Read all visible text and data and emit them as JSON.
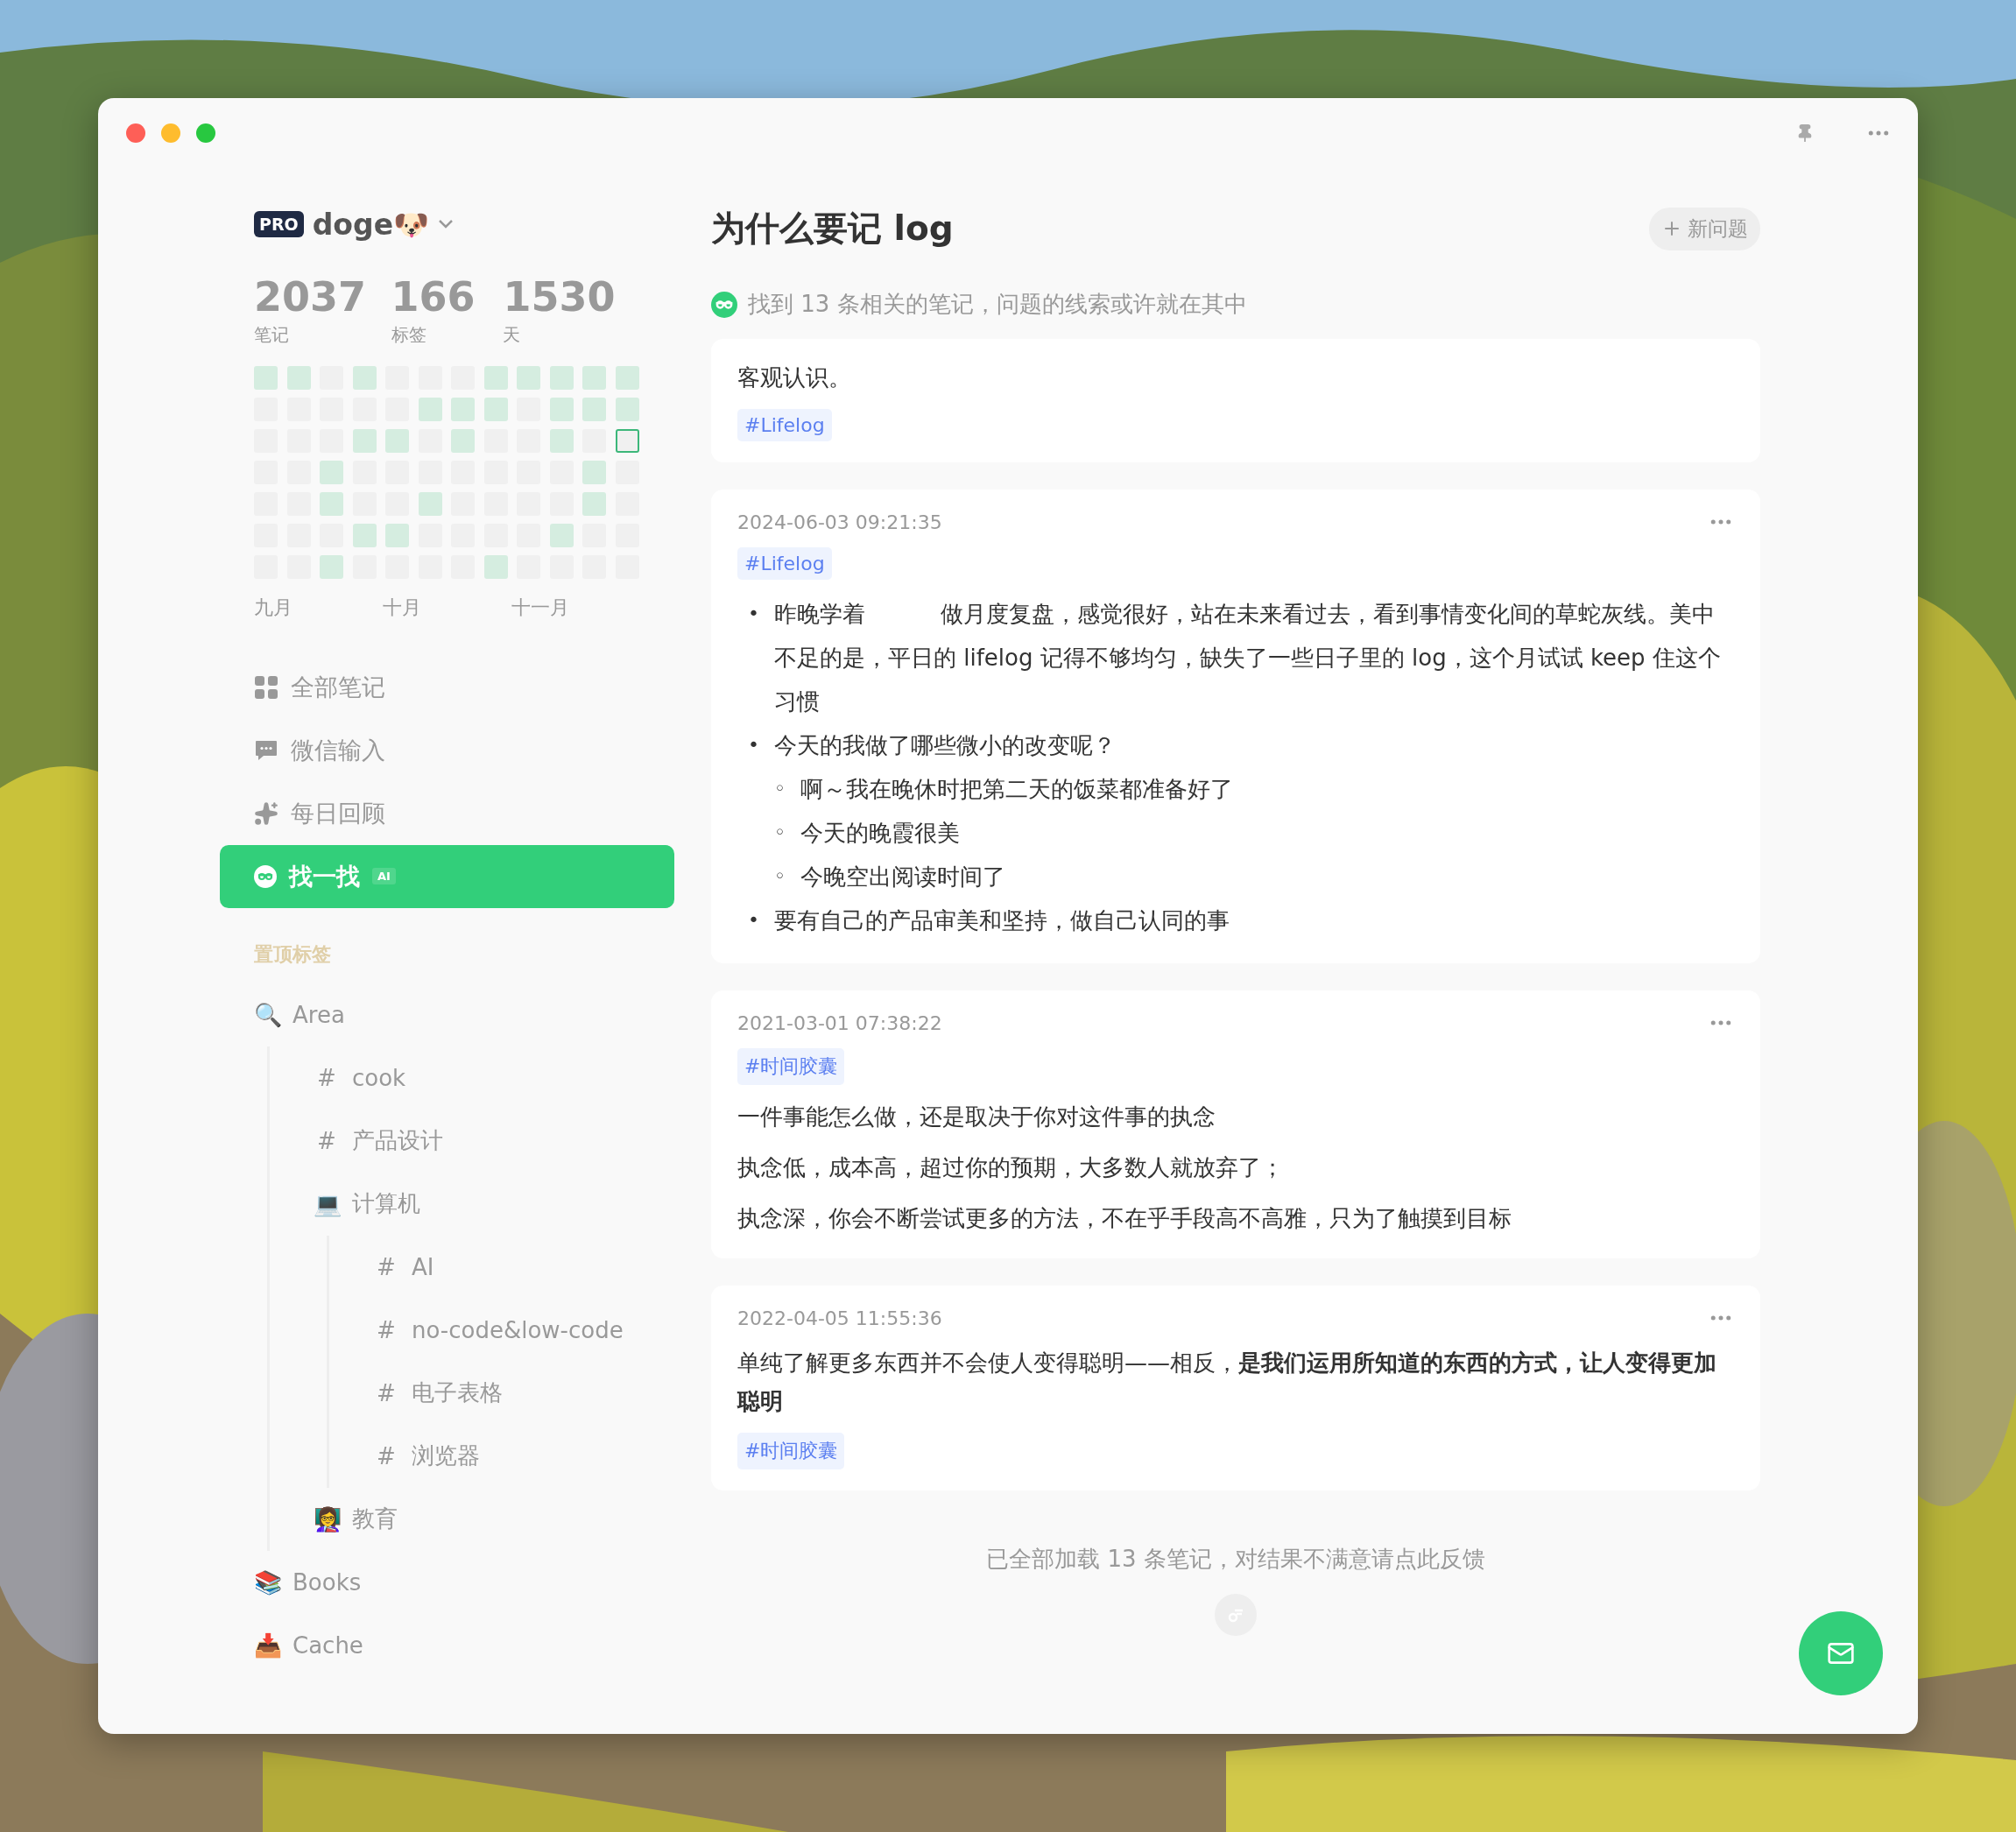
{
  "account": {
    "badge": "PRO",
    "name": "doge🐶"
  },
  "stats": [
    {
      "value": "2037",
      "label": "笔记"
    },
    {
      "value": "166",
      "label": "标签"
    },
    {
      "value": "1530",
      "label": "天"
    }
  ],
  "heatmap": {
    "rows": [
      [
        {
          "active": true,
          "today": false
        },
        {
          "active": true,
          "today": false
        },
        {
          "active": false,
          "today": false
        },
        {
          "active": true,
          "today": false
        },
        {
          "active": false,
          "today": false
        },
        {
          "active": false,
          "today": false
        },
        {
          "active": false,
          "today": false
        },
        {
          "active": true,
          "today": false
        },
        {
          "active": true,
          "today": false
        },
        {
          "active": true,
          "today": false
        },
        {
          "active": true,
          "today": false
        },
        {
          "active": true,
          "today": false
        }
      ],
      [
        {
          "active": false,
          "today": false
        },
        {
          "active": false,
          "today": false
        },
        {
          "active": false,
          "today": false
        },
        {
          "active": false,
          "today": false
        },
        {
          "active": false,
          "today": false
        },
        {
          "active": true,
          "today": false
        },
        {
          "active": true,
          "today": false
        },
        {
          "active": true,
          "today": false
        },
        {
          "active": false,
          "today": false
        },
        {
          "active": true,
          "today": false
        },
        {
          "active": true,
          "today": false
        },
        {
          "active": true,
          "today": false
        }
      ],
      [
        {
          "active": false,
          "today": false
        },
        {
          "active": false,
          "today": false
        },
        {
          "active": false,
          "today": false
        },
        {
          "active": true,
          "today": false
        },
        {
          "active": true,
          "today": false
        },
        {
          "active": false,
          "today": false
        },
        {
          "active": true,
          "today": false
        },
        {
          "active": false,
          "today": false
        },
        {
          "active": false,
          "today": false
        },
        {
          "active": true,
          "today": false
        },
        {
          "active": false,
          "today": false
        },
        {
          "active": false,
          "today": true
        }
      ],
      [
        {
          "active": false,
          "today": false
        },
        {
          "active": false,
          "today": false
        },
        {
          "active": true,
          "today": false
        },
        {
          "active": false,
          "today": false
        },
        {
          "active": false,
          "today": false
        },
        {
          "active": false,
          "today": false
        },
        {
          "active": false,
          "today": false
        },
        {
          "active": false,
          "today": false
        },
        {
          "active": false,
          "today": false
        },
        {
          "active": false,
          "today": false
        },
        {
          "active": true,
          "today": false
        },
        {
          "active": false,
          "today": false
        }
      ],
      [
        {
          "active": false,
          "today": false
        },
        {
          "active": false,
          "today": false
        },
        {
          "active": true,
          "today": false
        },
        {
          "active": false,
          "today": false
        },
        {
          "active": false,
          "today": false
        },
        {
          "active": true,
          "today": false
        },
        {
          "active": false,
          "today": false
        },
        {
          "active": false,
          "today": false
        },
        {
          "active": false,
          "today": false
        },
        {
          "active": false,
          "today": false
        },
        {
          "active": true,
          "today": false
        },
        {
          "active": false,
          "today": false
        }
      ],
      [
        {
          "active": false,
          "today": false
        },
        {
          "active": false,
          "today": false
        },
        {
          "active": false,
          "today": false
        },
        {
          "active": true,
          "today": false
        },
        {
          "active": true,
          "today": false
        },
        {
          "active": false,
          "today": false
        },
        {
          "active": false,
          "today": false
        },
        {
          "active": false,
          "today": false
        },
        {
          "active": false,
          "today": false
        },
        {
          "active": true,
          "today": false
        },
        {
          "active": false,
          "today": false
        },
        {
          "active": false,
          "today": false
        }
      ],
      [
        {
          "active": false,
          "today": false
        },
        {
          "active": false,
          "today": false
        },
        {
          "active": true,
          "today": false
        },
        {
          "active": false,
          "today": false
        },
        {
          "active": false,
          "today": false
        },
        {
          "active": false,
          "today": false
        },
        {
          "active": false,
          "today": false
        },
        {
          "active": true,
          "today": false
        },
        {
          "active": false,
          "today": false
        },
        {
          "active": false,
          "today": false
        },
        {
          "active": false,
          "today": false
        },
        {
          "active": false,
          "today": false
        }
      ]
    ],
    "months": [
      "九月",
      "十月",
      "十一月"
    ]
  },
  "nav": [
    {
      "kind": "grid",
      "label": "全部笔记",
      "selected": false
    },
    {
      "kind": "chat",
      "label": "微信输入",
      "selected": false
    },
    {
      "kind": "sparkle",
      "label": "每日回顾",
      "selected": false
    },
    {
      "kind": "search",
      "label": "找一找",
      "badge": "AI",
      "selected": true
    }
  ],
  "pinned": {
    "heading": "置顶标签",
    "tree": [
      {
        "icon": "🔍",
        "label": "Area",
        "children": [
          {
            "icon": "#",
            "label": "cook"
          },
          {
            "icon": "#",
            "label": "产品设计"
          },
          {
            "icon": "💻",
            "label": "计算机",
            "children": [
              {
                "icon": "#",
                "label": "AI"
              },
              {
                "icon": "#",
                "label": "no-code&low-code"
              },
              {
                "icon": "#",
                "label": "电子表格"
              },
              {
                "icon": "#",
                "label": "浏览器"
              }
            ]
          },
          {
            "icon": "👩‍🏫",
            "label": "教育"
          }
        ]
      },
      {
        "icon": "📚",
        "label": "Books"
      },
      {
        "icon": "📥",
        "label": "Cache"
      }
    ]
  },
  "main": {
    "title": "为什么要记 log",
    "new_button": "新问题",
    "summary": "找到 13 条相关的笔记，问题的线索或许就在其中",
    "notes": [
      {
        "blocks": [
          {
            "kind": "paragraph",
            "text": "客观认识。"
          },
          {
            "kind": "tag",
            "text": "#Lifelog"
          }
        ]
      },
      {
        "date": "2024-06-03 09:21:35",
        "blocks": [
          {
            "kind": "tag",
            "text": "#Lifelog"
          },
          {
            "kind": "list",
            "items": [
              {
                "marker": "•",
                "text": "昨晚学着　　　 做月度复盘，感觉很好，站在未来看过去，看到事情变化间的草蛇灰线。美中不足的是，平日的 lifelog 记得不够均匀，缺失了一些日子里的 log，这个月试试 keep 住这个习惯"
              },
              {
                "marker": "•",
                "text": "今天的我做了哪些微小的改变呢？",
                "children": [
                  {
                    "marker": "◦",
                    "text": "啊～我在晚休时把第二天的饭菜都准备好了"
                  },
                  {
                    "marker": "◦",
                    "text": "今天的晚霞很美"
                  },
                  {
                    "marker": "◦",
                    "text": "今晚空出阅读时间了"
                  }
                ]
              },
              {
                "marker": "•",
                "text": "要有自己的产品审美和坚持，做自己认同的事"
              }
            ]
          }
        ]
      },
      {
        "date": "2021-03-01 07:38:22",
        "blocks": [
          {
            "kind": "tag",
            "text": "#时间胶囊"
          },
          {
            "kind": "paragraph",
            "text": "一件事能怎么做，还是取决于你对这件事的执念"
          },
          {
            "kind": "paragraph",
            "text": "执念低，成本高，超过你的预期，大多数人就放弃了；"
          },
          {
            "kind": "paragraph",
            "text": "执念深，你会不断尝试更多的方法，不在乎手段高不高雅，只为了触摸到目标"
          }
        ]
      },
      {
        "date": "2022-04-05 11:55:36",
        "blocks": [
          {
            "kind": "paragraph",
            "text": "单纯了解更多东西并不会使人变得聪明——相反，**是我们运用所知道的东西的方式，让人变得更加聪明**",
            "tag": "#时间胶囊"
          }
        ]
      }
    ],
    "footer": "已全部加载 13 条笔记，对结果不满意请点此反馈"
  }
}
